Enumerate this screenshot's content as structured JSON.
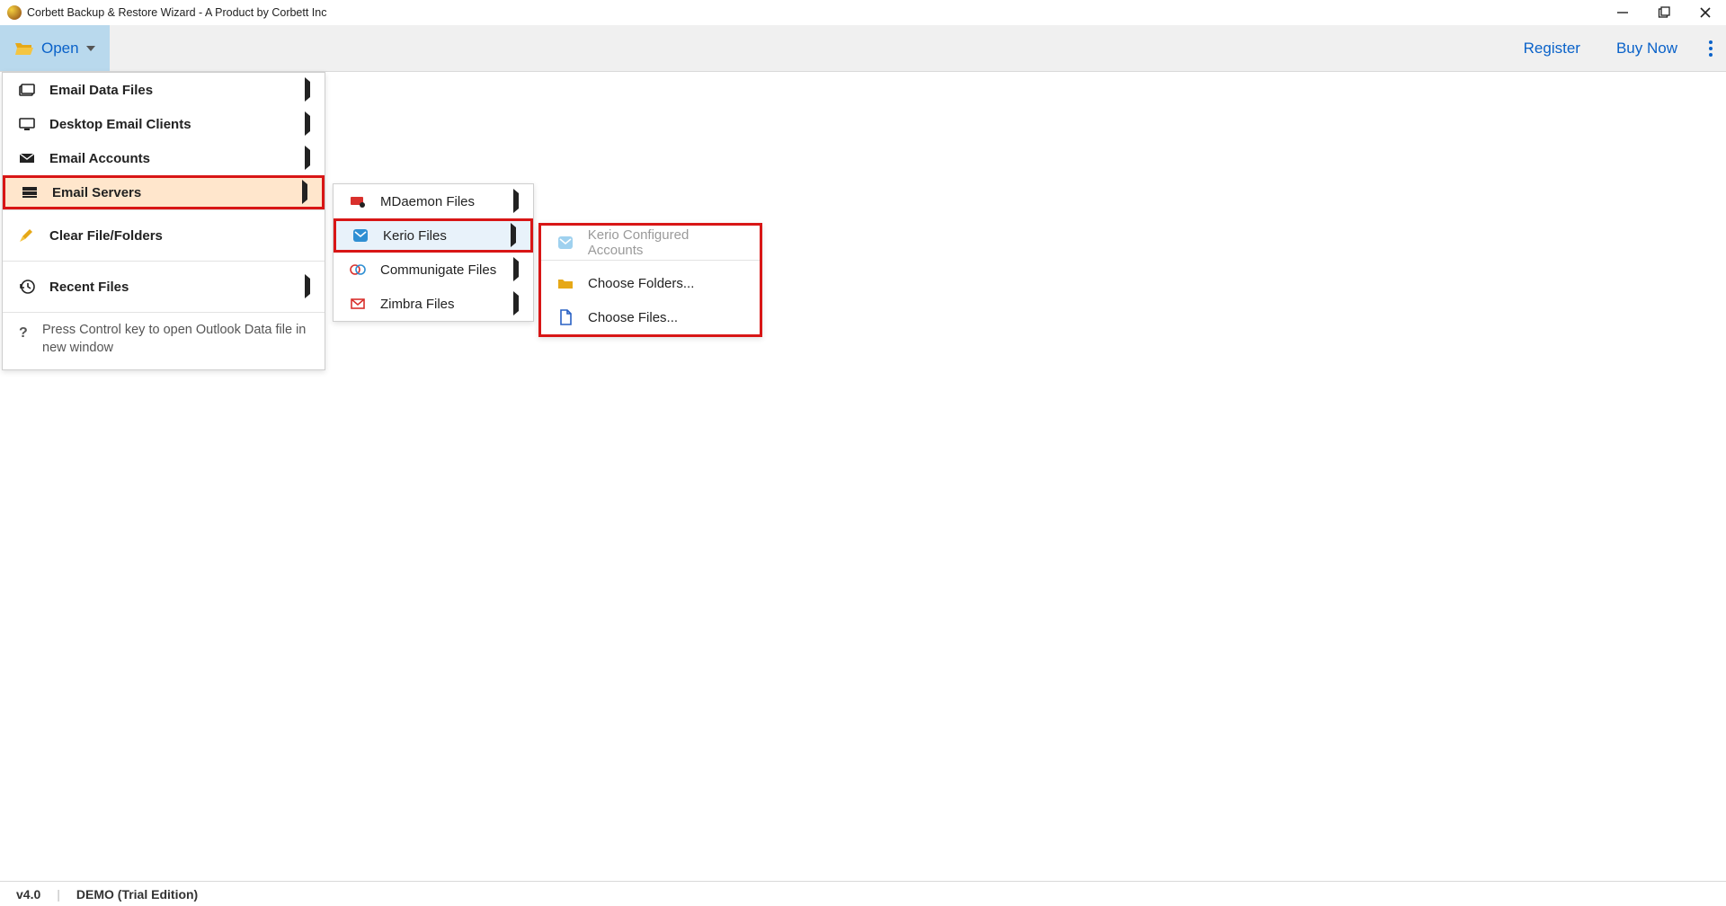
{
  "titlebar": {
    "title": "Corbett Backup & Restore Wizard - A Product by Corbett Inc"
  },
  "toolbar": {
    "open_label": "Open",
    "register_label": "Register",
    "buy_label": "Buy Now"
  },
  "menu1": {
    "items": [
      {
        "label": "Email Data Files"
      },
      {
        "label": "Desktop Email Clients"
      },
      {
        "label": "Email Accounts"
      },
      {
        "label": "Email Servers"
      },
      {
        "label": "Clear File/Folders"
      },
      {
        "label": "Recent Files"
      }
    ],
    "hint": "Press Control key to open Outlook Data file in new window"
  },
  "menu2": {
    "items": [
      {
        "label": "MDaemon Files"
      },
      {
        "label": "Kerio Files"
      },
      {
        "label": "Communigate Files"
      },
      {
        "label": "Zimbra Files"
      }
    ]
  },
  "menu3": {
    "items": [
      {
        "label": "Kerio Configured Accounts"
      },
      {
        "label": "Choose Folders..."
      },
      {
        "label": "Choose Files..."
      }
    ]
  },
  "status": {
    "version": "v4.0",
    "edition": "DEMO (Trial Edition)"
  }
}
